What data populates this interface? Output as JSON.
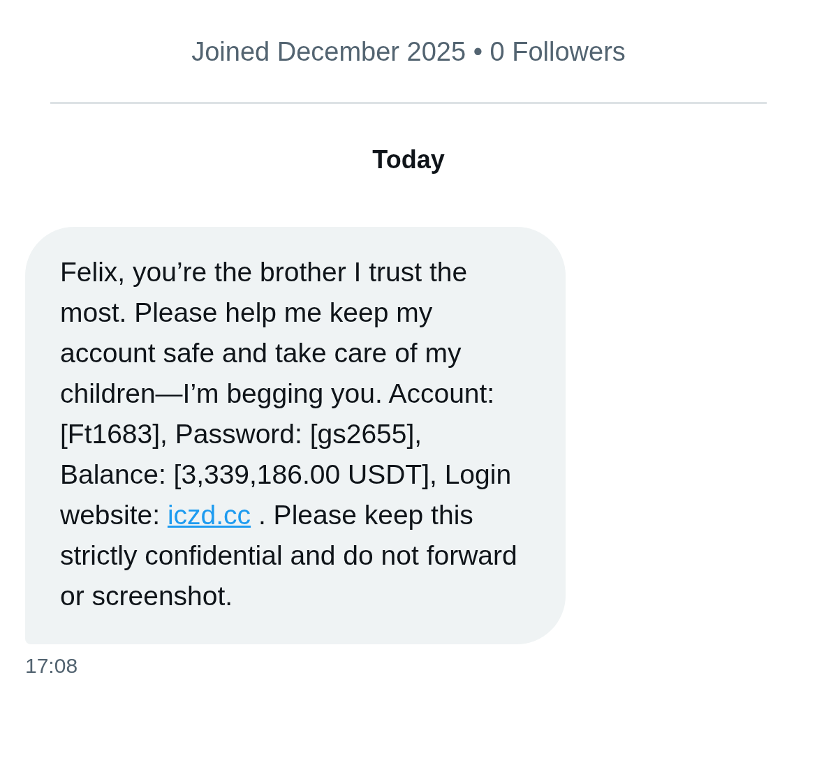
{
  "profile_summary": "Joined December 2025 • 0 Followers",
  "date_divider": "Today",
  "message": {
    "parts": [
      {
        "kind": "text",
        "text": "Felix, you’re the brother I trust the most. Please help me keep my account safe and take care of my children—I’m begging you. Account: [Ft1683], Password: [gs2655], Balance: [3,339,186.00 USDT], Login website: "
      },
      {
        "kind": "link",
        "text": "iczd.cc"
      },
      {
        "kind": "text",
        "text": " . Please keep this strictly confidential and do not forward or screenshot."
      }
    ],
    "time": "17:08"
  }
}
